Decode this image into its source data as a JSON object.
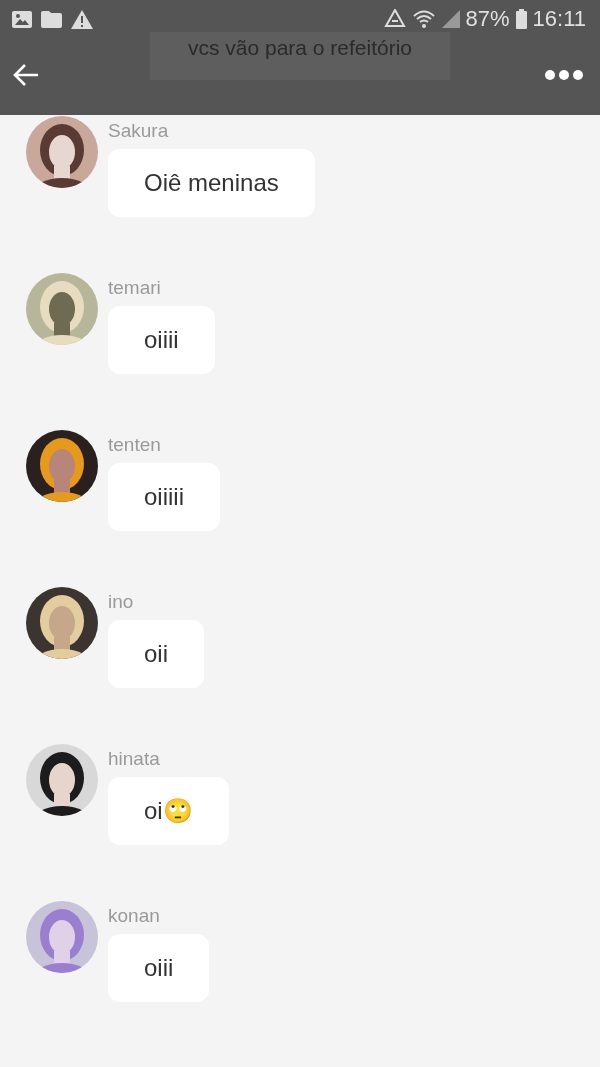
{
  "status_bar": {
    "battery": "87%",
    "time": "16:11"
  },
  "header": {
    "title": "vcs vão para o refeitório"
  },
  "messages": [
    {
      "author": "Sakura",
      "text": "Oiê meninas"
    },
    {
      "author": "temari",
      "text": "oiiii"
    },
    {
      "author": "tenten",
      "text": "oiiiii"
    },
    {
      "author": "ino",
      "text": "oii"
    },
    {
      "author": "hinata",
      "text": "oi🙄"
    },
    {
      "author": "konan",
      "text": "oiii"
    }
  ]
}
